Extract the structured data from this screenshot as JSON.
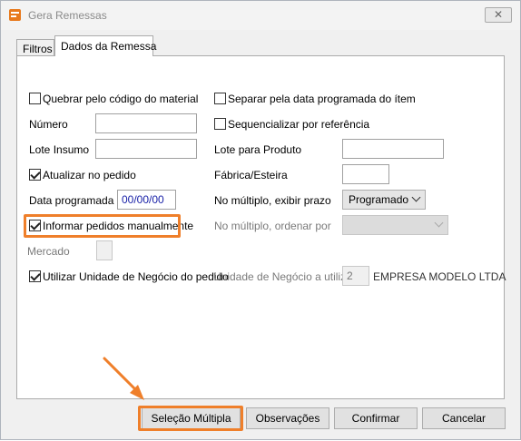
{
  "window": {
    "title": "Gera Remessas",
    "close_glyph": "✕"
  },
  "tabs": [
    {
      "label": "Filtros",
      "active": false
    },
    {
      "label": "Dados da Remessa",
      "active": true
    }
  ],
  "form": {
    "quebrar": {
      "label": "Quebrar pelo código do material",
      "checked": false
    },
    "separar": {
      "label": "Separar pela data programada do ítem",
      "checked": false
    },
    "numero": {
      "label": "Número",
      "value": ""
    },
    "sequencializar": {
      "label": "Sequencializar por referência",
      "checked": false
    },
    "lote_insumo": {
      "label": "Lote Insumo",
      "value": ""
    },
    "lote_produto": {
      "label": "Lote para Produto",
      "value": ""
    },
    "atualizar": {
      "label": "Atualizar no pedido",
      "checked": true
    },
    "fabrica": {
      "label": "Fábrica/Esteira",
      "value": ""
    },
    "data_programada": {
      "label": "Data programada",
      "value": "00/00/00"
    },
    "prazo": {
      "label": "No múltiplo, exibir prazo",
      "value": "Programado"
    },
    "informar": {
      "label": "Informar pedidos manualmente",
      "checked": true
    },
    "ordenar": {
      "label": "No múltiplo, ordenar por",
      "value": ""
    },
    "mercado": {
      "label": "Mercado",
      "value": ""
    },
    "utilizar": {
      "label": "Utilizar Unidade de Negócio do pedido",
      "checked": true
    },
    "unidade": {
      "label": "Unidade de Negócio a utilizar",
      "value": "2",
      "name": "EMPRESA MODELO LTDA"
    }
  },
  "buttons": {
    "selecao": "Seleção Múltipla",
    "observacoes": "Observações",
    "confirmar": "Confirmar",
    "cancelar": "Cancelar"
  },
  "colors": {
    "highlight": "#ef7f2a",
    "date_text": "#1a22a8"
  }
}
